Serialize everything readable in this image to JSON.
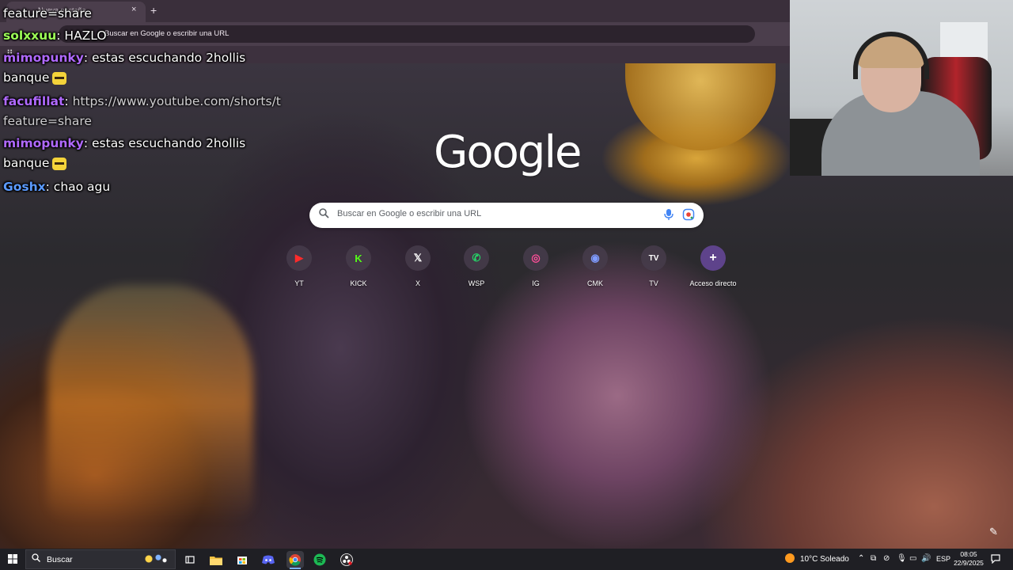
{
  "browser": {
    "tab_title": "Nueva pestaña",
    "tab_close": "×",
    "new_tab": "+",
    "omnibox_text": "Buscar en Google o escribir una URL"
  },
  "newtab": {
    "logo": "Google",
    "search_placeholder": "Buscar en Google o escribir una URL",
    "shortcuts": [
      {
        "label": "YT",
        "icon": "youtube-icon",
        "color": "#ff0000",
        "glyph": "▶"
      },
      {
        "label": "KICK",
        "icon": "kick-icon",
        "color": "#53fc18",
        "glyph": "K"
      },
      {
        "label": "X",
        "icon": "x-icon",
        "color": "#000000",
        "glyph": "𝕏"
      },
      {
        "label": "WSP",
        "icon": "whatsapp-icon",
        "color": "#25d366",
        "glyph": "✆"
      },
      {
        "label": "IG",
        "icon": "instagram-icon",
        "color": "#e1306c",
        "glyph": "◎"
      },
      {
        "label": "CMK",
        "icon": "cmk-icon",
        "color": "#3b5bdb",
        "glyph": "◉"
      },
      {
        "label": "TV",
        "icon": "tradingview-icon",
        "color": "#111111",
        "glyph": "TV"
      },
      {
        "label": "Acceso directo",
        "icon": "add-shortcut-icon",
        "color": "#5b3a8c",
        "glyph": "+"
      }
    ]
  },
  "chat": {
    "top_fragment": "feature=share",
    "lines": [
      {
        "user": "solxxuu",
        "user_color": "#9cff57",
        "sep": ": ",
        "text": "HAZLO"
      },
      {
        "user": "mimopunky",
        "user_color": "#b069ff",
        "sep": ": ",
        "text": "estas escuchando 2hollis"
      },
      {
        "cont": "banque"
      },
      {
        "user": "facufillat",
        "user_color": "#b069ff",
        "sep": ": ",
        "text": "https://www.youtube.com/shorts/t"
      },
      {
        "cont": "feature=share"
      },
      {
        "user": "mimopunky",
        "user_color": "#b069ff",
        "sep": ": ",
        "text": "estas escuchando 2hollis"
      },
      {
        "cont": "banque"
      },
      {
        "user": "Goshx",
        "user_color": "#5b9bff",
        "sep": ": ",
        "text": "chao agu"
      }
    ]
  },
  "taskbar": {
    "search_label": "Buscar",
    "weather": "10°C  Soleado",
    "language": "ESP",
    "time": "08:05",
    "date": "22/9/2025"
  }
}
